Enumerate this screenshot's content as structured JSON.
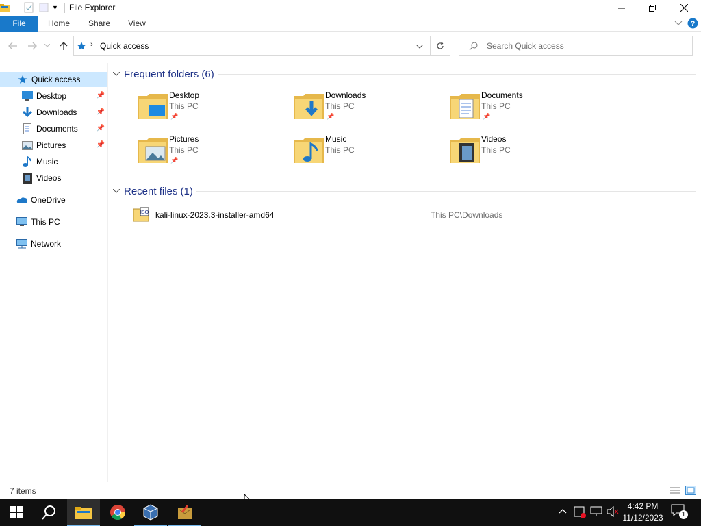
{
  "window": {
    "title": "File Explorer"
  },
  "ribbon": {
    "tabs": [
      "File",
      "Home",
      "Share",
      "View"
    ]
  },
  "address": {
    "path": "Quick access",
    "search_placeholder": "Search Quick access"
  },
  "nav": {
    "quick_access": "Quick access",
    "items": [
      {
        "label": "Desktop",
        "pinned": true
      },
      {
        "label": "Downloads",
        "pinned": true
      },
      {
        "label": "Documents",
        "pinned": true
      },
      {
        "label": "Pictures",
        "pinned": true
      },
      {
        "label": "Music",
        "pinned": false
      },
      {
        "label": "Videos",
        "pinned": false
      }
    ],
    "onedrive": "OneDrive",
    "this_pc": "This PC",
    "network": "Network"
  },
  "frequent": {
    "header": "Frequent folders (6)",
    "folders": [
      {
        "name": "Desktop",
        "location": "This PC",
        "pinned": true,
        "icon": "desktop-folder-icon"
      },
      {
        "name": "Downloads",
        "location": "This PC",
        "pinned": true,
        "icon": "downloads-folder-icon"
      },
      {
        "name": "Documents",
        "location": "This PC",
        "pinned": true,
        "icon": "documents-folder-icon"
      },
      {
        "name": "Pictures",
        "location": "This PC",
        "pinned": true,
        "icon": "pictures-folder-icon"
      },
      {
        "name": "Music",
        "location": "This PC",
        "pinned": false,
        "icon": "music-folder-icon"
      },
      {
        "name": "Videos",
        "location": "This PC",
        "pinned": false,
        "icon": "videos-folder-icon"
      }
    ]
  },
  "recent": {
    "header": "Recent files (1)",
    "files": [
      {
        "name": "kali-linux-2023.3-installer-amd64",
        "path": "This PC\\Downloads",
        "icon": "iso-file-icon"
      }
    ]
  },
  "status": {
    "items": "7 items"
  },
  "taskbar": {
    "time": "4:42 PM",
    "date": "11/12/2023",
    "notifications": "1"
  },
  "colors": {
    "accent": "#1979ca",
    "selected": "#cce8ff",
    "header": "#1e3287",
    "taskbar": "#101010"
  }
}
